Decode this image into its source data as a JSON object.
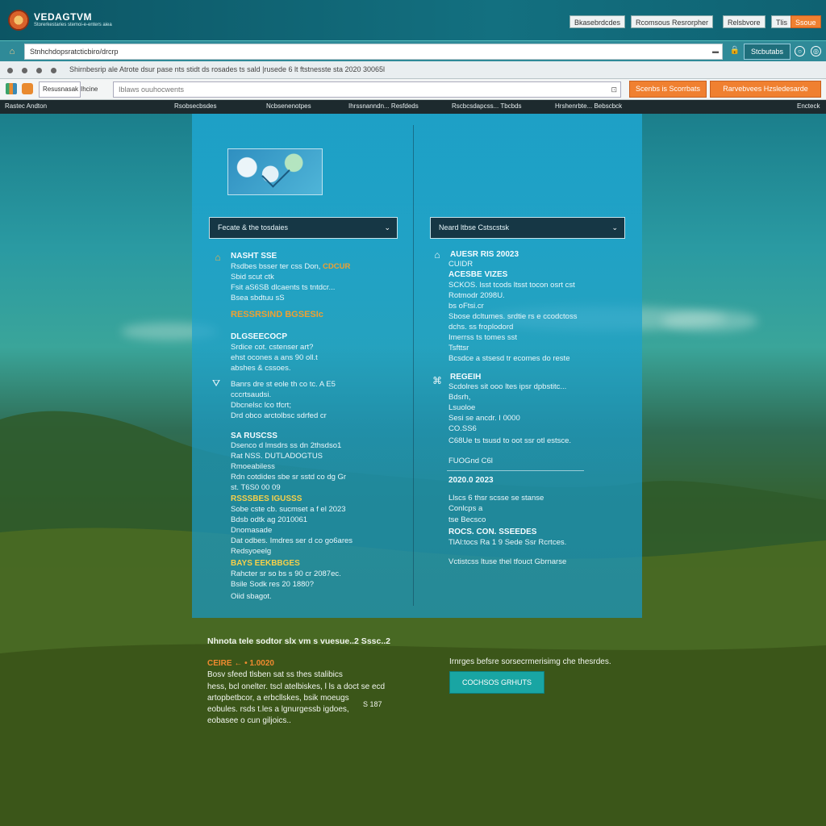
{
  "header": {
    "brand": "VEDAGTVM",
    "brand_sub": "Storerkestaries stemoi-e-enters aiea",
    "buttons": [
      "Bkasebrdcdes",
      "Rcomsous Resrorpher",
      "Relsbvore",
      "Tlis",
      "Ssoue"
    ]
  },
  "address": {
    "url": "Stnhchdopsratcticbiro/drcrp",
    "go_label": "Stcbutabs"
  },
  "nav": {
    "text": "Shirnbesrip ale Atrote dsur pase nts stidt ds rosades ts sald |rusede 6 lt ftstnesste sta 2020 30065l"
  },
  "toolbar": {
    "field1": "Resusnasak",
    "field2": "Ihcine",
    "search_placeholder": "Iblaws ouuhocwents",
    "btn1": "Scenbs is Scorrbats",
    "btn2": "Rarvebvees Hzsledesarde"
  },
  "menu": {
    "left": "Rastec Andton",
    "items": [
      "Rsobsecbsdes",
      "Ncbsenenotpes",
      "Ihrssnanndn... Resfdeds",
      "Rscbcsdapcss... Tbcbds",
      "Hrshenrbte... Bebscbck"
    ],
    "right": "Encteck"
  },
  "panel": {
    "left_select": "Fecate & the tosdaies",
    "right_select": "Neard ltbse Cstscstsk",
    "left": {
      "s1_head": "NASHT SSE",
      "s1_lines": [
        [
          "Rsdbes bsser ter css  Don, ",
          "CDCUR"
        ],
        [
          "Sbid scut ctk"
        ],
        [
          "Fsit aS6SB dlcaents ts  tntdcr..."
        ],
        [
          "Bsea  sbdtuu   sS"
        ]
      ],
      "s1_orange": "RESSRSIND BGSESIc",
      "s2_head": "DLGSEECOCP",
      "s2_lines": [
        "Srdice cot. cstenser art?",
        "ehst ocones a ans 90 oll.t",
        "abshes & cssoes."
      ],
      "s3_lines": [
        "Banrs dre st eole th co tc. A E5",
        "cccrtsaudsi.",
        "Dbcnelsc lco tfcrt;",
        "Drd obco arctolbsc sdrfed cr"
      ],
      "s4_head": "SA RUSCSS",
      "s4_lines": [
        "Dsenco d lmsdrs ss dn 2thsdso1",
        "Rat NSS.   DUTLADOGTUS",
        "Rmoeabiless",
        "Rdn cotdides sbe  sr sstd co dg Gr",
        "st. T6S0 00 09"
      ],
      "s5_head": "RSSSBES  IGUSSS",
      "s5_lines": [
        "Sobe cste cb. sucmset a  f el 2023",
        "Bdsb odtk ag 2010061",
        "Dnomasade",
        "Dat odbes. Imdres ser d co go6ares",
        "Redsyoeelg"
      ],
      "s6_head": "BAYS   EEKBBGES",
      "s6_lines": [
        "Rahcter sr so bs s 90 cr 2087ec.",
        "Bsile  Sodk res 20 1880?",
        "Oiid sbagot."
      ]
    },
    "right": {
      "r1_head": "AUESR RIS 20023",
      "r1_sub": "CUIDR",
      "r1_head2": "ACESBE  VIZES",
      "r1_lines": [
        "SCKOS. lsst tcods ltsst tocon osrt cst",
        "Rotmodr 2098U.",
        "bs oFtsi.cr",
        "Sbose dcltumes. srdtie rs e ccodctoss",
        "dchs.  ss froplodord",
        "Imerrss ts tomes  sst",
        "Tsfttsr",
        "Bcsdce a stsesd  tr ecomes do reste"
      ],
      "r2_head": "REGEIH",
      "r2_lines": [
        "Scdolres sit ooo  ltes ipsr dpbstitc...",
        "Bdsrh,",
        "Lsuoloe",
        "Sesi se ancdr. I 0000",
        "CO.SS6",
        "C68Ue  ts tsusd  to oot ssr otl estsce.",
        "FUOGnd C6l"
      ],
      "r3_head": "2020.0  2023",
      "r3_lines": [
        "Llscs  6  thsr  scsse se stanse",
        "Conlcps  a",
        "tse  Becsco"
      ],
      "r3_head2": "ROCS.  CON. SSEEDES",
      "r3_lines2": [
        "TlAl:tocs  Ra  1 9  Sede   Ssr Rcrtces.",
        "Vctistcss  ltuse thel tfouct Gbrnarse"
      ]
    }
  },
  "below": {
    "title": "Nhnota tele sodtor slx vm s vuesue..2 Sssc..2",
    "orange": "CEIRE  ←  •  1.0020",
    "lines": [
      "Bosv  sfeed tlsben sat ss  thes stalibics",
      "hess,  bcl onelter. tscl atelbiskes, l ls a doct se ecd",
      "artopbetbcor,  a  erbcllskes,  bsik moeugs",
      "eobules.  rsds  t.les a lgnurgessb  igdoes,",
      "eobasee  o cun giljoics.."
    ],
    "note": "S 187",
    "right_text": "Irnrges befsre  sorsecrmerisimg  che thesrdes.",
    "cta": "COCHSOS  GRHUTS"
  }
}
